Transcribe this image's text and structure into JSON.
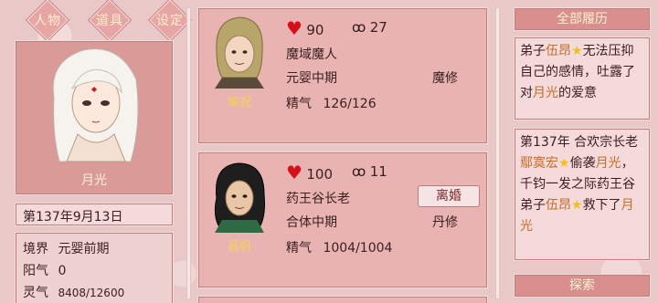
{
  "nav": {
    "character": "人物",
    "items": "道具",
    "settings": "设定"
  },
  "player": {
    "name": "月光",
    "date": "第137年9月13日",
    "realm_label": "境界",
    "realm_value": "元婴前期",
    "yang_label": "阳气",
    "yang_value": "0",
    "spirit_label": "灵气",
    "spirit_value": "8408/12600"
  },
  "partners": [
    {
      "name": "喻祝",
      "affection": "90",
      "bond": "27",
      "title": "魔域魔人",
      "realm": "元婴中期",
      "path": "魔修",
      "essence_label": "精气",
      "essence": "126/126"
    },
    {
      "name": "昌帆",
      "affection": "100",
      "bond": "11",
      "title": "药王谷长老",
      "realm": "合体中期",
      "path": "丹修",
      "essence_label": "精气",
      "essence": "1004/1004",
      "action": "离婚"
    }
  ],
  "history": {
    "title": "全部履历",
    "entry1": {
      "p1": "弟子",
      "hl1": "伍昂",
      "p2": "无法压抑自己的感情，吐露了对",
      "hl2": "月光",
      "p3": "的爱意"
    },
    "entry2": {
      "p1": "第137年 合欢宗长老",
      "hl1": "鄢寞宏",
      "p2": "偷袭",
      "hl2": "月光",
      "p3": "，千钧一发之际药王谷弟子",
      "hl3": "伍昂",
      "p4": "救下了",
      "hl4": "月光"
    },
    "explore": "探索"
  },
  "colors": {
    "heart": "#d4101a",
    "highlight": "#c56e2a",
    "star": "#f0c020",
    "name": "#f6d257"
  }
}
